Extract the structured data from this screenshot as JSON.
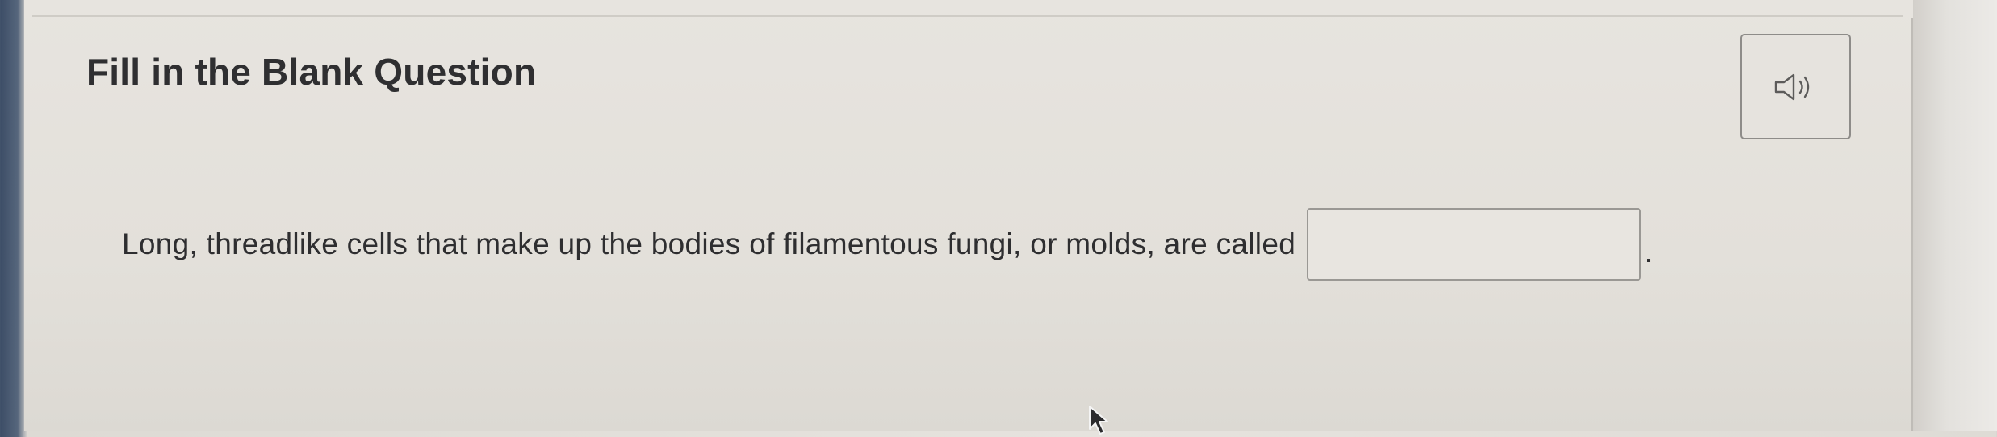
{
  "question": {
    "heading": "Fill in the Blank Question",
    "prompt": "Long, threadlike cells that make up the bodies of filamentous fungi, or molds, are called",
    "answer_value": "",
    "trailing_punctuation": "."
  },
  "audio_button": {
    "icon": "speaker-icon"
  },
  "colors": {
    "text": "#2e2e30",
    "border": "#9a9894",
    "background": "#e6e3de"
  }
}
